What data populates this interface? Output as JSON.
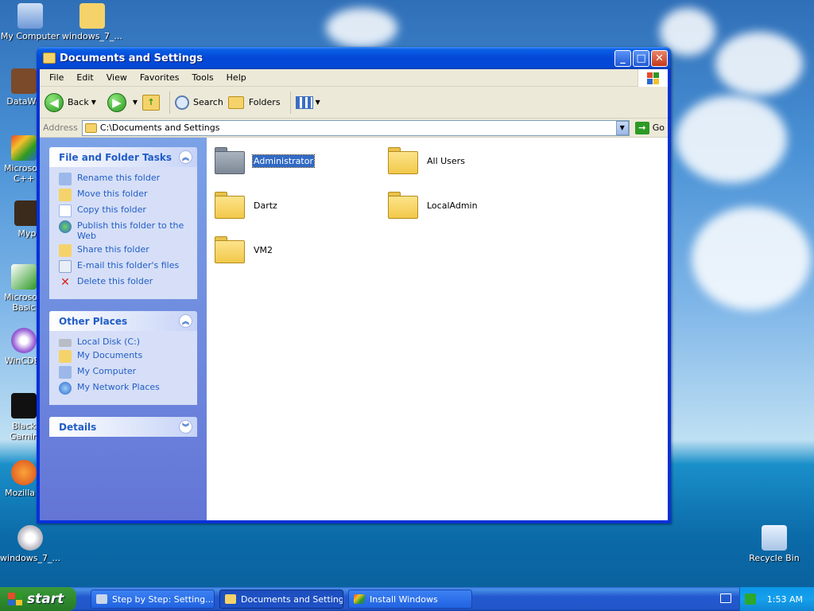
{
  "desktop": {
    "icons": [
      {
        "label": "My Computer"
      },
      {
        "label": "windows_7_..."
      },
      {
        "label": "DataWa"
      },
      {
        "label": "Microsoft\nC++"
      },
      {
        "label": "Myp"
      },
      {
        "label": "Microsoft\nBasic"
      },
      {
        "label": "WinCDEr"
      },
      {
        "label": "Black\nGamin"
      },
      {
        "label": "Mozilla F"
      },
      {
        "label": "windows_7_..."
      },
      {
        "label": "Recycle Bin"
      }
    ]
  },
  "window": {
    "title": "Documents and Settings",
    "menu": [
      "File",
      "Edit",
      "View",
      "Favorites",
      "Tools",
      "Help"
    ],
    "toolbar": {
      "back": "Back",
      "search": "Search",
      "folders": "Folders"
    },
    "address": {
      "label": "Address",
      "value": "C:\\Documents and Settings",
      "go": "Go"
    },
    "tasks_panel": {
      "title": "File and Folder Tasks",
      "items": [
        "Rename this folder",
        "Move this folder",
        "Copy this folder",
        "Publish this folder to the Web",
        "Share this folder",
        "E-mail this folder's files",
        "Delete this folder"
      ]
    },
    "places_panel": {
      "title": "Other Places",
      "items": [
        "Local Disk (C:)",
        "My Documents",
        "My Computer",
        "My Network Places"
      ]
    },
    "details_panel": {
      "title": "Details"
    },
    "folders": [
      {
        "name": "Administrator",
        "selected": true
      },
      {
        "name": "All Users"
      },
      {
        "name": "Dartz"
      },
      {
        "name": "LocalAdmin"
      },
      {
        "name": "VM2"
      }
    ]
  },
  "taskbar": {
    "start": "start",
    "buttons": [
      {
        "label": "Step by Step: Setting..."
      },
      {
        "label": "Documents and Settings"
      },
      {
        "label": "Install Windows"
      }
    ],
    "clock": "1:53 AM"
  }
}
